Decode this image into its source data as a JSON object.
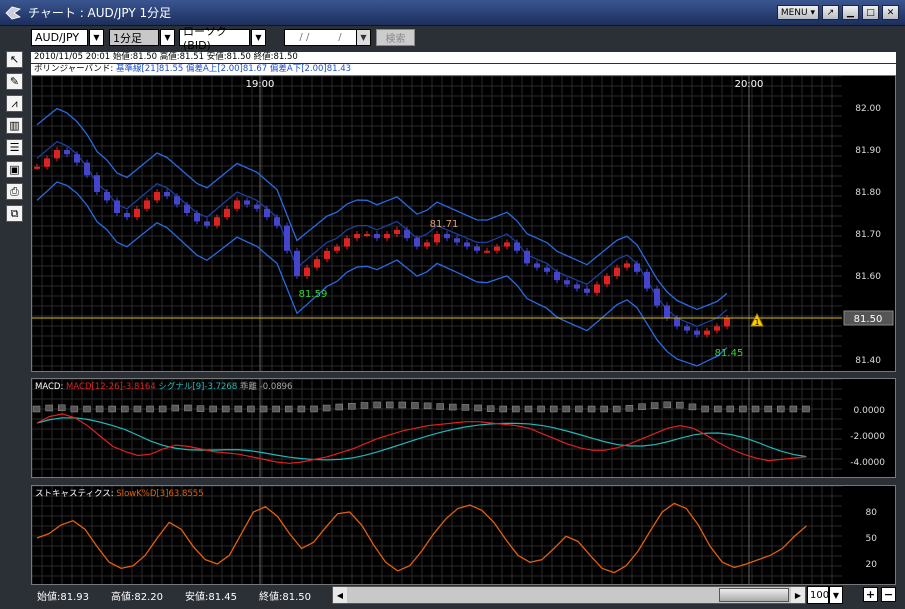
{
  "window": {
    "title": "チャート : AUD/JPY 1分足",
    "menu_label": "MENU"
  },
  "toolbar": {
    "symbol": "AUD/JPY",
    "timeframe": "1分足",
    "chart_type": "ローソク(BID)",
    "date_placeholder": "/ /",
    "search_label": "検索"
  },
  "info": {
    "ohlc": "2010/11/05 20:01 始値:81.50 高値:81.51 安値:81.50 終値:81.50",
    "bb_name": "ボリンジャーバンド:",
    "bb_values": "基準線[21]81.55 偏差A上[2.00]81.67 偏差A下[2.00]81.43"
  },
  "main_chart": {
    "time_labels": [
      "19:00",
      "20:00"
    ],
    "y_labels": [
      "82.00",
      "81.90",
      "81.80",
      "81.70",
      "81.60",
      "81.50",
      "81.40"
    ],
    "current_price": "81.50",
    "annotations": {
      "high": "81.71",
      "low1": "81.59",
      "low2": "81.45"
    },
    "alert_label": "1",
    "colors": {
      "up": "#dd2222",
      "down": "#4444cc",
      "band": "#2a6ae0",
      "price_line": "#e0c000"
    }
  },
  "macd": {
    "name": "MACD:",
    "macd_label": "MACD[12-26]-3.8164",
    "signal_label": "シグナル[9]-3.7268",
    "diff_label": "乖離 -0.0896",
    "y_labels": [
      "0.0000",
      "-2.0000",
      "-4.0000"
    ],
    "colors": {
      "macd": "#dd2222",
      "signal": "#20b8b8",
      "hist": "#888888"
    }
  },
  "stoch": {
    "name": "ストキャスティクス:",
    "label": "SlowK%D[3]63.8555",
    "y_labels": [
      "80",
      "50",
      "20"
    ],
    "color": "#e06010"
  },
  "footer": {
    "open": "始値:81.93",
    "high": "高値:82.20",
    "low": "安値:81.45",
    "close": "終値:81.50",
    "zoom": "100"
  }
}
